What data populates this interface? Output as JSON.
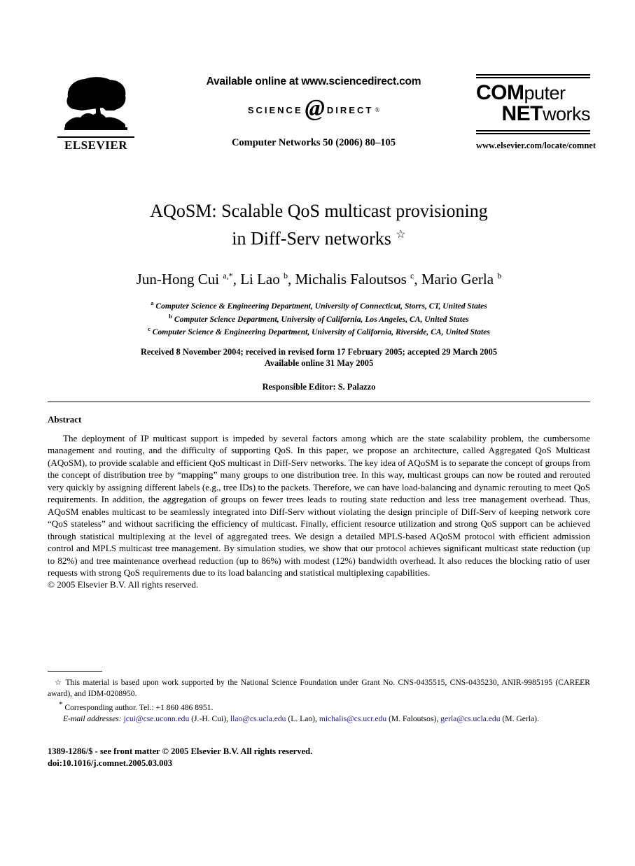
{
  "masthead": {
    "publisher_name": "ELSEVIER",
    "publisher_logo_icon": "elsevier-tree-icon",
    "available_online": "Available online at www.sciencedirect.com",
    "sciencedirect_left": "SCIENCE",
    "sciencedirect_at": "@",
    "sciencedirect_right": "DIRECT",
    "sciencedirect_reg": "®",
    "journal_reference": "Computer Networks 50 (2006) 80–105",
    "journal_logo_line1_bold": "COM",
    "journal_logo_line1_thin": "puter",
    "journal_logo_line2_bold": "NET",
    "journal_logo_line2_thin": "works",
    "journal_url": "www.elsevier.com/locate/comnet"
  },
  "article": {
    "title_line1": "AQoSM: Scalable QoS multicast provisioning",
    "title_line2": "in Diff-Serv networks",
    "title_footnote_marker": "☆",
    "authors_html": "Jun-Hong Cui <sup>a,*</sup>, Li Lao <sup>b</sup>, Michalis Faloutsos <sup>c</sup>, Mario Gerla <sup>b</sup>",
    "affiliations": [
      {
        "marker": "a",
        "text": "Computer Science & Engineering Department, University of Connecticut, Storrs, CT, United States"
      },
      {
        "marker": "b",
        "text": "Computer Science Department, University of California, Los Angeles, CA, United States"
      },
      {
        "marker": "c",
        "text": "Computer Science & Engineering Department, University of California, Riverside, CA, United States"
      }
    ],
    "history_line1": "Received 8 November 2004; received in revised form 17 February 2005; accepted 29 March 2005",
    "history_line2": "Available online 31 May 2005",
    "responsible_editor": "Responsible Editor: S. Palazzo"
  },
  "abstract": {
    "heading": "Abstract",
    "body": "The deployment of IP multicast support is impeded by several factors among which are the state scalability problem, the cumbersome management and routing, and the difficulty of supporting QoS. In this paper, we propose an architecture, called Aggregated QoS Multicast (AQoSM), to provide scalable and efficient QoS multicast in Diff-Serv networks. The key idea of AQoSM is to separate the concept of groups from the concept of distribution tree by “mapping” many groups to one distribution tree. In this way, multicast groups can now be routed and rerouted very quickly by assigning different labels (e.g., tree IDs) to the packets. Therefore, we can have load-balancing and dynamic rerouting to meet QoS requirements. In addition, the aggregation of groups on fewer trees leads to routing state reduction and less tree management overhead. Thus, AQoSM enables multicast to be seamlessly integrated into Diff-Serv without violating the design principle of Diff-Serv of keeping network core “QoS stateless” and without sacrificing the efficiency of multicast. Finally, efficient resource utilization and strong QoS support can be achieved through statistical multiplexing at the level of aggregated trees. We design a detailed MPLS-based AQoSM protocol with efficient admission control and MPLS multicast tree management. By simulation studies, we show that our protocol achieves significant multicast state reduction (up to 82%) and tree maintenance overhead reduction (up to 86%) with modest (12%) bandwidth overhead. It also reduces the blocking ratio of user requests with strong QoS requirements due to its load balancing and statistical multiplexing capabilities.",
    "copyright": "© 2005 Elsevier B.V. All rights reserved."
  },
  "footnotes": {
    "grant_marker": "☆",
    "grant_text": "This material is based upon work supported by the National Science Foundation under Grant No. CNS-0435515, CNS-0435230, ANIR-9985195 (CAREER award), and IDM-0208950.",
    "corresponding_marker": "*",
    "corresponding_text": "Corresponding author. Tel.: +1 860 486 8951.",
    "email_label": "E-mail addresses:",
    "emails": [
      {
        "address": "jcui@cse.uconn.edu",
        "owner": "(J.-H. Cui),"
      },
      {
        "address": "llao@cs.ucla.edu",
        "owner": "(L. Lao),"
      },
      {
        "address": "michalis@cs.ucr.edu",
        "owner": "(M. Faloutsos),"
      },
      {
        "address": "gerla@cs.ucla.edu",
        "owner": "(M. Gerla)."
      }
    ]
  },
  "imprint": {
    "issn_line": "1389-1286/$ - see front matter © 2005 Elsevier B.V. All rights reserved.",
    "doi_line": "doi:10.1016/j.comnet.2005.03.003"
  },
  "colors": {
    "link": "#1a1a8c",
    "text": "#000000",
    "background": "#ffffff"
  }
}
